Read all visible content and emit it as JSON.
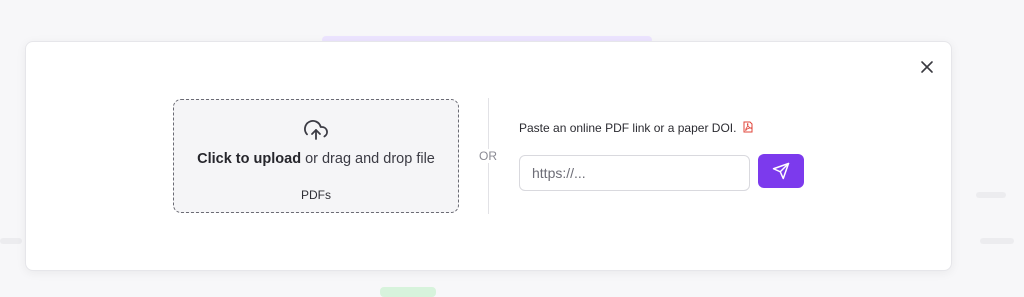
{
  "dropzone": {
    "bold_label": "Click to upload",
    "rest_label": " or drag and drop file",
    "file_types": "PDFs"
  },
  "divider": {
    "label": "OR"
  },
  "link_input": {
    "hint": "Paste an online PDF link or a paper DOI.",
    "placeholder": "https://...",
    "value": ""
  },
  "icons": {
    "close": "close-icon",
    "upload": "cloud-upload-icon",
    "pdf": "pdf-file-icon",
    "submit": "send-icon"
  },
  "colors": {
    "accent": "#7c3aed",
    "pdf_icon": "#e0443a"
  }
}
